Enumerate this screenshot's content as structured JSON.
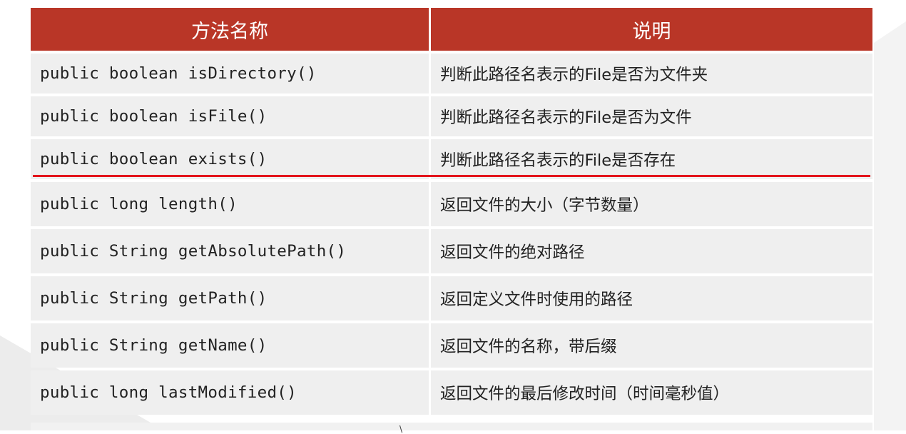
{
  "table": {
    "headers": {
      "method": "方法名称",
      "description": "说明"
    },
    "rows": [
      {
        "method": "public boolean isDirectory()",
        "description": "判断此路径名表示的File是否为文件夹"
      },
      {
        "method": "public boolean isFile()",
        "description": "判断此路径名表示的File是否为文件"
      },
      {
        "method": "public boolean exists()",
        "description": "判断此路径名表示的File是否存在"
      },
      {
        "method": "public long length()",
        "description": "返回文件的大小（字节数量）"
      },
      {
        "method": "public String getAbsolutePath()",
        "description": "返回文件的绝对路径"
      },
      {
        "method": "public String getPath()",
        "description": "返回定义文件时使用的路径"
      },
      {
        "method": "public String getName()",
        "description": "返回文件的名称，带后缀"
      },
      {
        "method": "public long lastModified()",
        "description": "返回文件的最后修改时间（时间毫秒值）"
      }
    ]
  },
  "colors": {
    "header_bg": "#b93627",
    "row_bg": "#efefef",
    "separator_red": "#e3141c"
  }
}
